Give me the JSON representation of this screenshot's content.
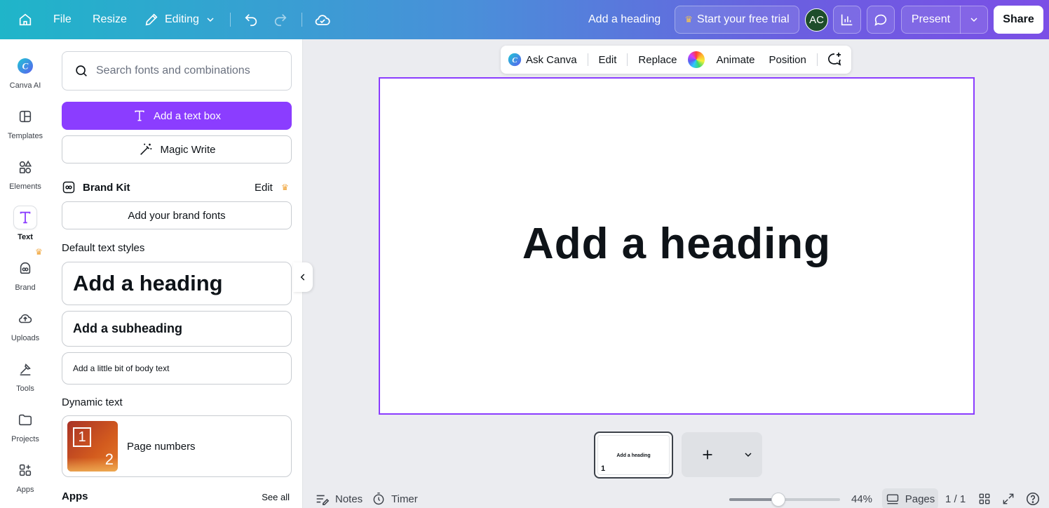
{
  "topbar": {
    "file": "File",
    "resize": "Resize",
    "mode": "Editing",
    "design_title": "Add a heading",
    "trial": "Start your free trial",
    "avatar_initials": "AC",
    "present": "Present",
    "share": "Share"
  },
  "rail": {
    "items": [
      {
        "label": "Canva AI",
        "icon": "canva-ai-icon"
      },
      {
        "label": "Templates",
        "icon": "templates-icon"
      },
      {
        "label": "Elements",
        "icon": "elements-icon"
      },
      {
        "label": "Text",
        "icon": "text-icon",
        "active": true
      },
      {
        "label": "Brand",
        "icon": "brand-icon"
      },
      {
        "label": "Uploads",
        "icon": "uploads-icon"
      },
      {
        "label": "Tools",
        "icon": "tools-icon"
      },
      {
        "label": "Projects",
        "icon": "projects-icon"
      },
      {
        "label": "Apps",
        "icon": "apps-icon"
      }
    ]
  },
  "panel": {
    "search_placeholder": "Search fonts and combinations",
    "add_text_box": "Add a text box",
    "magic_write": "Magic Write",
    "brand_kit": "Brand Kit",
    "brand_kit_edit": "Edit",
    "add_brand_fonts": "Add your brand fonts",
    "default_styles_title": "Default text styles",
    "heading": "Add a heading",
    "subheading": "Add a subheading",
    "body": "Add a little bit of body text",
    "dynamic_title": "Dynamic text",
    "page_numbers": "Page numbers",
    "apps_title": "Apps",
    "see_all": "See all"
  },
  "context_bar": {
    "ask_canva": "Ask Canva",
    "edit": "Edit",
    "replace": "Replace",
    "animate": "Animate",
    "position": "Position"
  },
  "canvas": {
    "heading": "Add a heading",
    "thumb_title": "Add a heading",
    "thumb_number": "1"
  },
  "bottom": {
    "notes": "Notes",
    "timer": "Timer",
    "zoom": "44%",
    "zoom_fraction": 0.44,
    "pages": "Pages",
    "page_count": "1 / 1"
  },
  "colors": {
    "accent": "#8b3dff",
    "crown": "#f0a53b"
  }
}
